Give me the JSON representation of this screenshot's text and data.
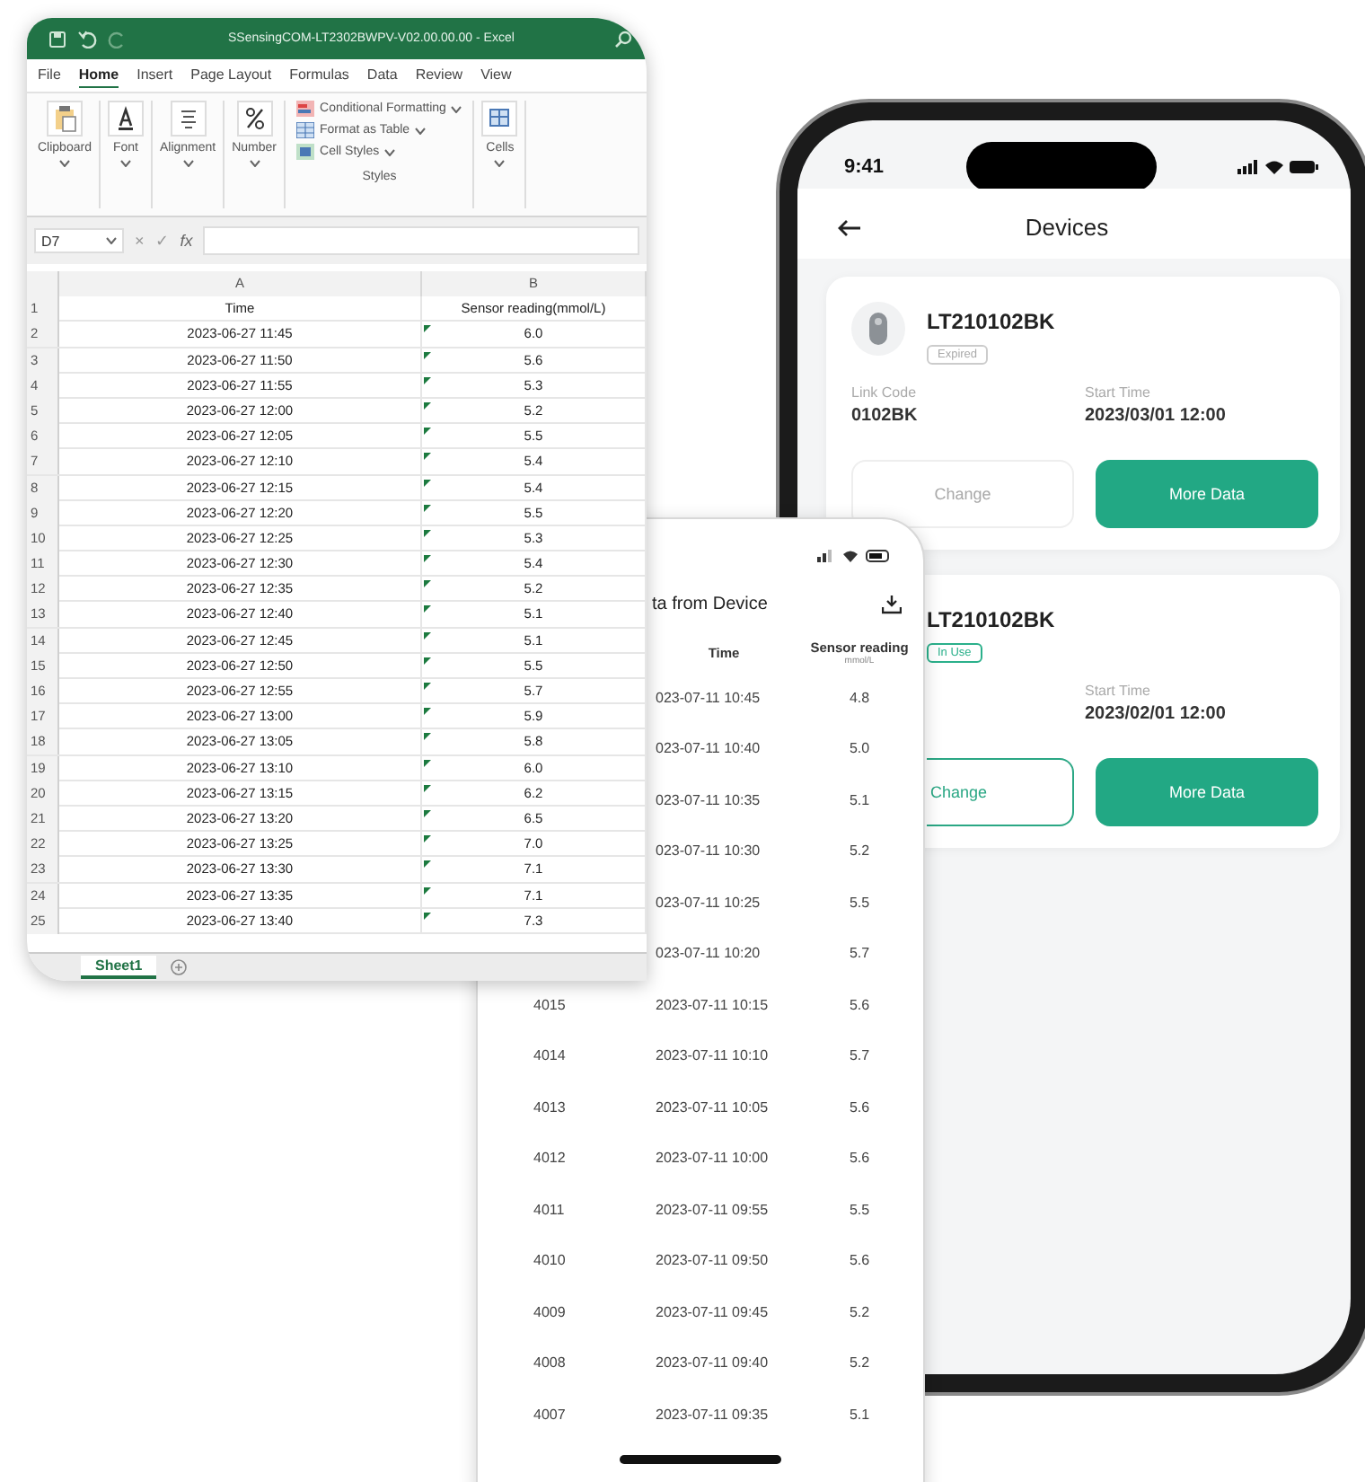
{
  "spreadsheet": {
    "title": "SSensingCOM-LT2302BWPV-V02.00.00.00 - Excel",
    "tabs": [
      {
        "label": "File",
        "selected": false
      },
      {
        "label": "Home",
        "selected": true
      },
      {
        "label": "Insert",
        "selected": false
      },
      {
        "label": "Page Layout",
        "selected": false
      },
      {
        "label": "Formulas",
        "selected": false
      },
      {
        "label": "Data",
        "selected": false
      },
      {
        "label": "Review",
        "selected": false
      },
      {
        "label": "View",
        "selected": false
      }
    ],
    "ribbon": [
      {
        "kind": "paste",
        "label": "Clipboard"
      },
      {
        "kind": "font",
        "label": "Font"
      },
      {
        "kind": "alignment",
        "label": "Alignment"
      },
      {
        "kind": "number",
        "label": "Number"
      },
      {
        "kind": "styles",
        "label": "Styles",
        "items": [
          {
            "kind": "conditional",
            "label": "Conditional Formatting"
          },
          {
            "kind": "table",
            "label": "Format as Table"
          },
          {
            "kind": "cellstyles",
            "label": "Cell Styles"
          }
        ]
      },
      {
        "kind": "cells",
        "label": "Cells"
      }
    ],
    "formula_bar": {
      "name_box": "D7",
      "cancel": "×",
      "enter": "✓",
      "function": "fx"
    },
    "columns": [
      "A",
      "B"
    ],
    "rows": [
      {
        "number": "1",
        "cells": [
          "Time",
          "Sensor reading(mmol/L)"
        ],
        "warning": false
      },
      {
        "number": "2",
        "cells": [
          "2023-06-27 11:45",
          "6.0"
        ],
        "warning": true
      },
      {
        "number": "3",
        "cells": [
          "2023-06-27 11:50",
          "5.6"
        ],
        "warning": true
      },
      {
        "number": "4",
        "cells": [
          "2023-06-27 11:55",
          "5.3"
        ],
        "warning": true
      },
      {
        "number": "5",
        "cells": [
          "2023-06-27 12:00",
          "5.2"
        ],
        "warning": true
      },
      {
        "number": "6",
        "cells": [
          "2023-06-27 12:05",
          "5.5"
        ],
        "warning": true
      },
      {
        "number": "7",
        "cells": [
          "2023-06-27 12:10",
          "5.4"
        ],
        "warning": true
      },
      {
        "number": "8",
        "cells": [
          "2023-06-27 12:15",
          "5.4"
        ],
        "warning": true
      },
      {
        "number": "9",
        "cells": [
          "2023-06-27 12:20",
          "5.5"
        ],
        "warning": true
      },
      {
        "number": "10",
        "cells": [
          "2023-06-27 12:25",
          "5.3"
        ],
        "warning": true
      },
      {
        "number": "11",
        "cells": [
          "2023-06-27 12:30",
          "5.4"
        ],
        "warning": true
      },
      {
        "number": "12",
        "cells": [
          "2023-06-27 12:35",
          "5.2"
        ],
        "warning": true
      },
      {
        "number": "13",
        "cells": [
          "2023-06-27 12:40",
          "5.1"
        ],
        "warning": true
      },
      {
        "number": "14",
        "cells": [
          "2023-06-27 12:45",
          "5.1"
        ],
        "warning": true
      },
      {
        "number": "15",
        "cells": [
          "2023-06-27 12:50",
          "5.5"
        ],
        "warning": true
      },
      {
        "number": "16",
        "cells": [
          "2023-06-27 12:55",
          "5.7"
        ],
        "warning": true
      },
      {
        "number": "17",
        "cells": [
          "2023-06-27 13:00",
          "5.9"
        ],
        "warning": true
      },
      {
        "number": "18",
        "cells": [
          "2023-06-27 13:05",
          "5.8"
        ],
        "warning": true
      },
      {
        "number": "19",
        "cells": [
          "2023-06-27 13:10",
          "6.0"
        ],
        "warning": true
      },
      {
        "number": "20",
        "cells": [
          "2023-06-27 13:15",
          "6.2"
        ],
        "warning": true
      },
      {
        "number": "21",
        "cells": [
          "2023-06-27 13:20",
          "6.5"
        ],
        "warning": true
      },
      {
        "number": "22",
        "cells": [
          "2023-06-27 13:25",
          "7.0"
        ],
        "warning": true
      },
      {
        "number": "23",
        "cells": [
          "2023-06-27 13:30",
          "7.1"
        ],
        "warning": true
      },
      {
        "number": "24",
        "cells": [
          "2023-06-27 13:35",
          "7.1"
        ],
        "warning": true
      },
      {
        "number": "25",
        "cells": [
          "2023-06-27 13:40",
          "7.3"
        ],
        "warning": true
      }
    ],
    "sheet_tabs": [
      {
        "label": "Sheet1",
        "selected": true
      }
    ]
  },
  "data_phone": {
    "title": "ta from Device",
    "columns": [
      "Time",
      "Sensor reading"
    ],
    "unit": "mmol/L",
    "rows": [
      {
        "time": "023-07-11 10:45",
        "reading": "4.8"
      },
      {
        "time": "023-07-11 10:40",
        "reading": "5.0"
      },
      {
        "time": "023-07-11 10:35",
        "reading": "5.1"
      },
      {
        "time": "023-07-11 10:30",
        "reading": "5.2"
      },
      {
        "time": "023-07-11 10:25",
        "reading": "5.5"
      },
      {
        "time": "023-07-11 10:20",
        "reading": "5.7"
      },
      {
        "id": "4015",
        "time": "2023-07-11 10:15",
        "reading": "5.6"
      },
      {
        "id": "4014",
        "time": "2023-07-11 10:10",
        "reading": "5.7"
      },
      {
        "id": "4013",
        "time": "2023-07-11 10:05",
        "reading": "5.6"
      },
      {
        "id": "4012",
        "time": "2023-07-11 10:00",
        "reading": "5.6"
      },
      {
        "id": "4011",
        "time": "2023-07-11 09:55",
        "reading": "5.5"
      },
      {
        "id": "4010",
        "time": "2023-07-11 09:50",
        "reading": "5.6"
      },
      {
        "id": "4009",
        "time": "2023-07-11 09:45",
        "reading": "5.2"
      },
      {
        "id": "4008",
        "time": "2023-07-11 09:40",
        "reading": "5.2"
      },
      {
        "id": "4007",
        "time": "2023-07-11 09:35",
        "reading": "5.1"
      }
    ]
  },
  "devices_phone": {
    "status_time": "9:41",
    "title": "Devices",
    "devices": [
      {
        "name": "LT210102BK",
        "status": {
          "label": "Expired",
          "kind": "expired"
        },
        "link_code_label": "Link Code",
        "link_code": "0102BK",
        "start_time_label": "Start Time",
        "start_time": "2023/03/01 12:00",
        "buttons": [
          {
            "label": "Change",
            "kind": "secondary",
            "disabled": true
          },
          {
            "label": "More Data",
            "kind": "primary",
            "disabled": false
          }
        ]
      },
      {
        "name": "LT210102BK",
        "status": {
          "label": "In Use",
          "kind": "in_use"
        },
        "start_time_label": "Start Time",
        "start_time": "2023/02/01 12:00",
        "buttons": [
          {
            "label": "Change",
            "kind": "secondary",
            "disabled": false
          },
          {
            "label": "More Data",
            "kind": "primary",
            "disabled": false
          }
        ]
      }
    ]
  }
}
